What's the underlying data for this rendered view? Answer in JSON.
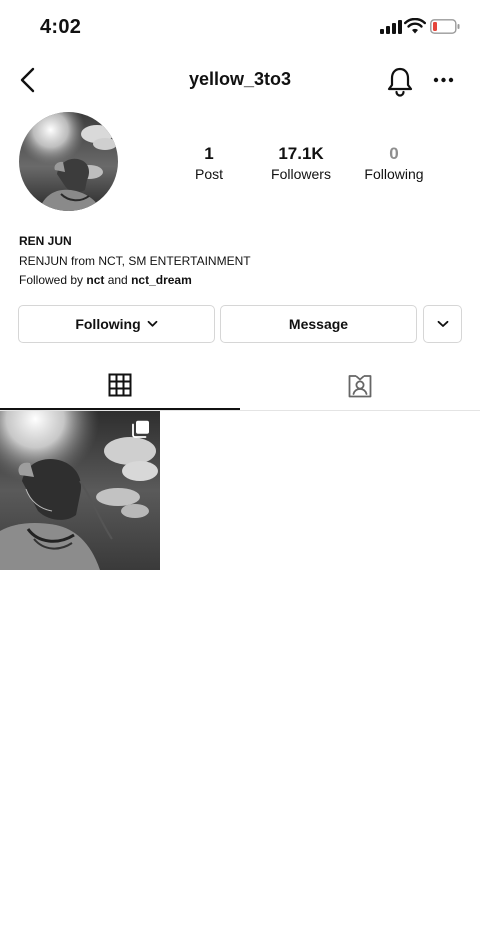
{
  "status_bar": {
    "time": "4:02"
  },
  "header": {
    "username": "yellow_3to3"
  },
  "stats": [
    {
      "value": "1",
      "label": "Post"
    },
    {
      "value": "17.1K",
      "label": "Followers"
    },
    {
      "value": "0",
      "label": "Following"
    }
  ],
  "bio": {
    "name": "REN JUN",
    "description": "RENJUN from NCT, SM ENTERTAINMENT",
    "followed_prefix": "Followed by ",
    "followed_user_1": "nct",
    "followed_and": " and ",
    "followed_user_2": "nct_dream"
  },
  "buttons": {
    "following": "Following",
    "message": "Message"
  },
  "icons": {
    "back": "chevron-left-icon",
    "notifications": "bell-icon",
    "more": "more-horizontal-icon",
    "grid_tab": "grid-icon",
    "tagged_tab": "tagged-person-icon",
    "multi_post": "carousel-icon"
  },
  "colors": {
    "battery_low": "#e5453b",
    "muted_text": "#8e8e8e",
    "border": "#d6d6d6"
  }
}
